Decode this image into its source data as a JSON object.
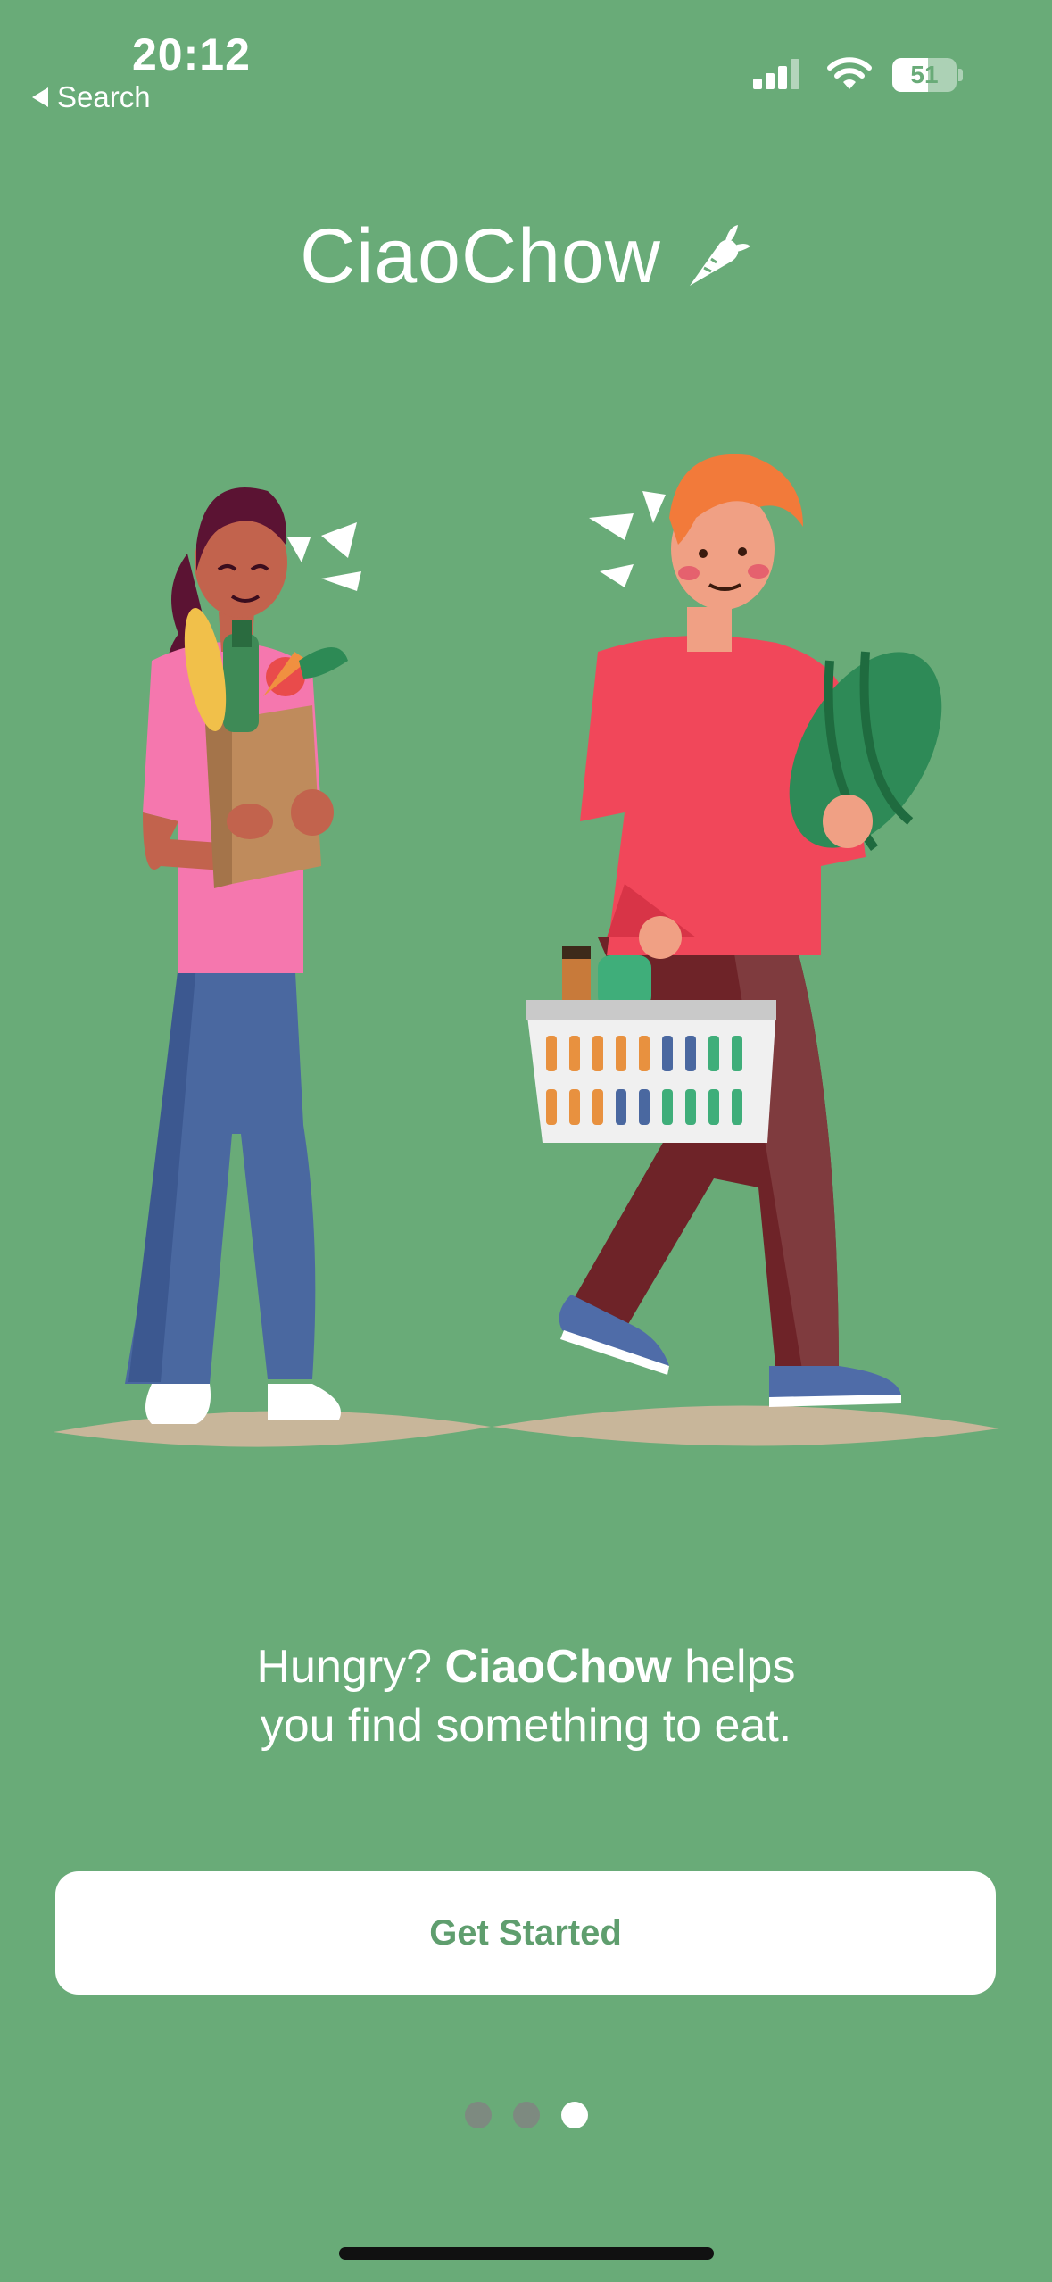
{
  "status_bar": {
    "time": "20:12",
    "back_label": "Search",
    "battery": "51"
  },
  "brand": {
    "name": "CiaoChow",
    "icon": "carrot-icon"
  },
  "tagline": {
    "line1_prefix": "Hungry? ",
    "brand": "CiaoChow",
    "line1_suffix": " helps",
    "line2": "you find something to eat."
  },
  "cta": {
    "label": "Get Started"
  },
  "pager": {
    "total": 3,
    "active_index": 2
  },
  "colors": {
    "background": "#69AB78",
    "button_text": "#5F9E6E",
    "button_bg": "#FFFFFF"
  }
}
